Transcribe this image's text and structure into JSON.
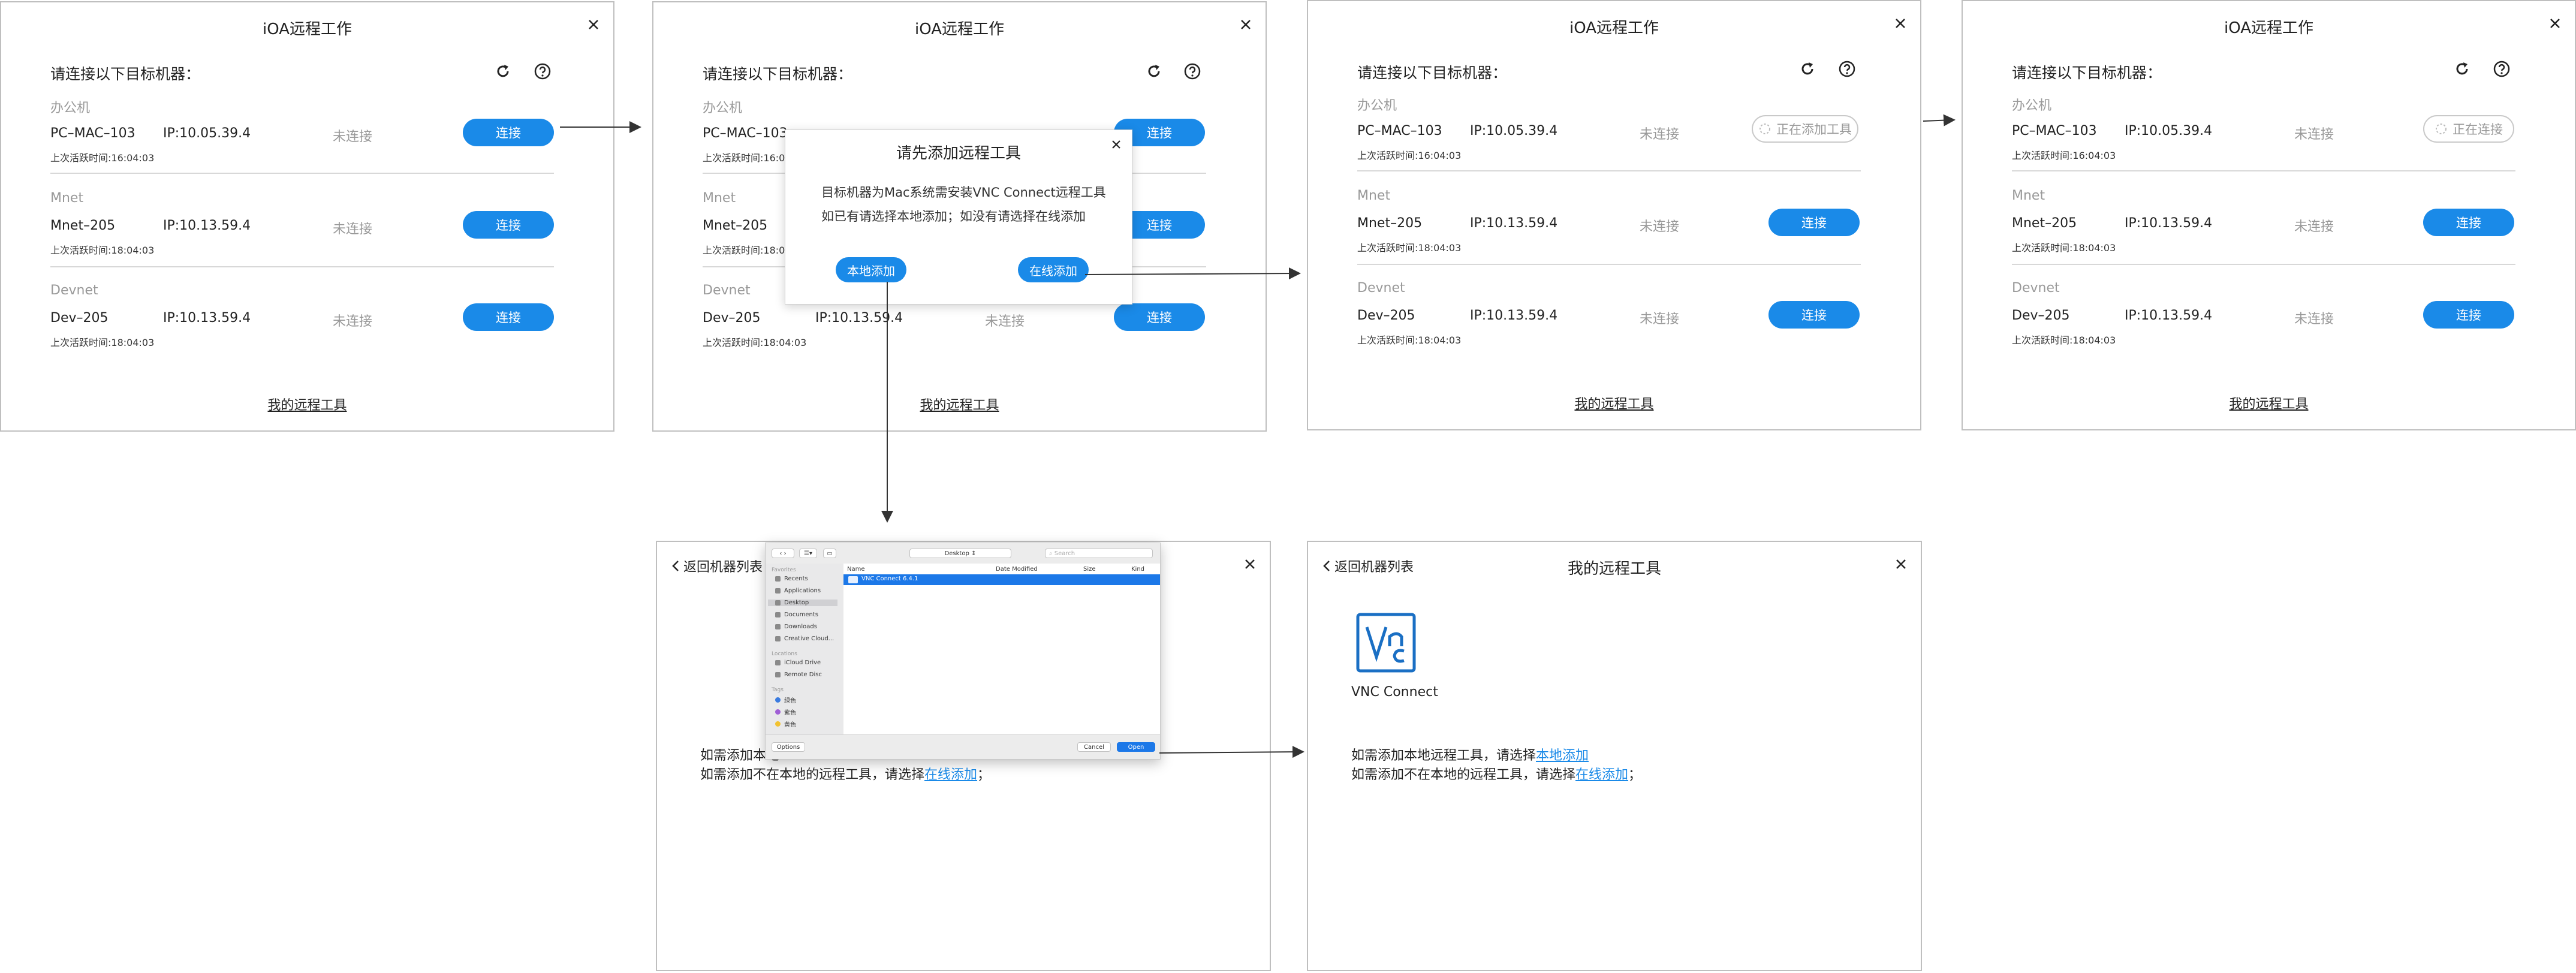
{
  "app_title": "iOA远程工作",
  "subhead": "请连接以下目标机器：",
  "my_tools_link": "我的远程工具",
  "machines": [
    {
      "group": "办公机",
      "name": "PC–MAC–103",
      "ip": "IP:10.05.39.4",
      "status": "未连接",
      "last": "上次活跃时间:16:04:03"
    },
    {
      "group": "Mnet",
      "name": "Mnet–205",
      "ip": "IP:10.13.59.4",
      "status": "未连接",
      "last": "上次活跃时间:18:04:03"
    },
    {
      "group": "Devnet",
      "name": "Dev–205",
      "ip": "IP:10.13.59.4",
      "status": "未连接",
      "last": "上次活跃时间:18:04:03"
    }
  ],
  "connect_label": "连接",
  "adding_label": "正在添加工具",
  "connecting_label": "正在连接",
  "modal": {
    "title": "请先添加远程工具",
    "line1": "目标机器为Mac系统需安装VNC Connect远程工具",
    "line2": "如已有请选择本地添加；如没有请选择在线添加",
    "local_btn": "本地添加",
    "online_btn": "在线添加"
  },
  "back_label": "返回机器列表",
  "tools_title": "我的远程工具",
  "info_line1_prefix": "如需添加本地远程工具，请选择",
  "info_line1_link": "本地添加",
  "info_line2_prefix": "如需添加不在本地的远程工具，请选择",
  "info_line2_link": "在线添加",
  "info_line2_suffix": "；",
  "bg_info_line1_visible": "如需添加本地",
  "vnc_label": "VNC Connect",
  "file_dialog": {
    "location": "Desktop",
    "search_placeholder": "Search",
    "favorites_header": "Favorites",
    "favorites": [
      "Recents",
      "Applications",
      "Desktop",
      "Documents",
      "Downloads",
      "Creative Cloud..."
    ],
    "locations_header": "Locations",
    "locations": [
      "iCloud Drive",
      "Remote Disc"
    ],
    "tags_header": "Tags",
    "tags": [
      {
        "name": "绿色",
        "color": "#3a7be0"
      },
      {
        "name": "紫色",
        "color": "#a05fd6"
      },
      {
        "name": "黄色",
        "color": "#f2c230"
      }
    ],
    "columns": [
      "Name",
      "Date Modified",
      "Size",
      "Kind"
    ],
    "selected_file": "VNC Connect 6.4.1",
    "options_label": "Options",
    "cancel_label": "Cancel",
    "open_label": "Open"
  },
  "colors": {
    "accent": "#1a8ae8",
    "border": "#bfbfbf",
    "muted": "#999999"
  }
}
